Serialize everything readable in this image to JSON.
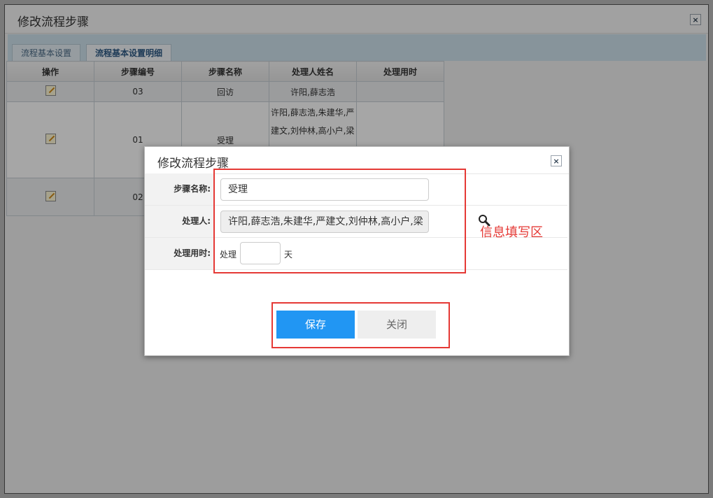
{
  "outer_dialog": {
    "title": "修改流程步骤",
    "close": "×"
  },
  "tabs": [
    {
      "label": "流程基本设置"
    },
    {
      "label": "流程基本设置明细"
    }
  ],
  "table": {
    "headers": [
      "操作",
      "步骤编号",
      "步骤名称",
      "处理人姓名",
      "处理用时"
    ],
    "rows": [
      {
        "step_no": "03",
        "step_name": "回访",
        "handlers": "许阳,薛志浩",
        "duration": ""
      },
      {
        "step_no": "01",
        "step_name": "受理",
        "handlers": "许阳,薛志浩,朱建华,严建文,刘仲林,高小户,梁",
        "duration": ""
      },
      {
        "step_no": "02",
        "step_name": "",
        "handlers": "",
        "duration": ""
      }
    ]
  },
  "inner_dialog": {
    "title": "修改流程步骤",
    "close": "×",
    "fields": {
      "step_name_label": "步骤名称:",
      "step_name_value": "受理",
      "handler_label": "处理人:",
      "handler_value": "许阳,薛志浩,朱建华,严建文,刘仲林,高小户,梁",
      "duration_label": "处理用时:",
      "duration_prefix": "处理",
      "duration_value": "",
      "duration_unit": "天"
    },
    "save_label": "保存",
    "close_label": "关闭"
  },
  "annotation": {
    "text": "信息填写区",
    "color": "#e53935"
  },
  "colors": {
    "save_button": "#2196f3",
    "annotation_border": "#e53935"
  }
}
